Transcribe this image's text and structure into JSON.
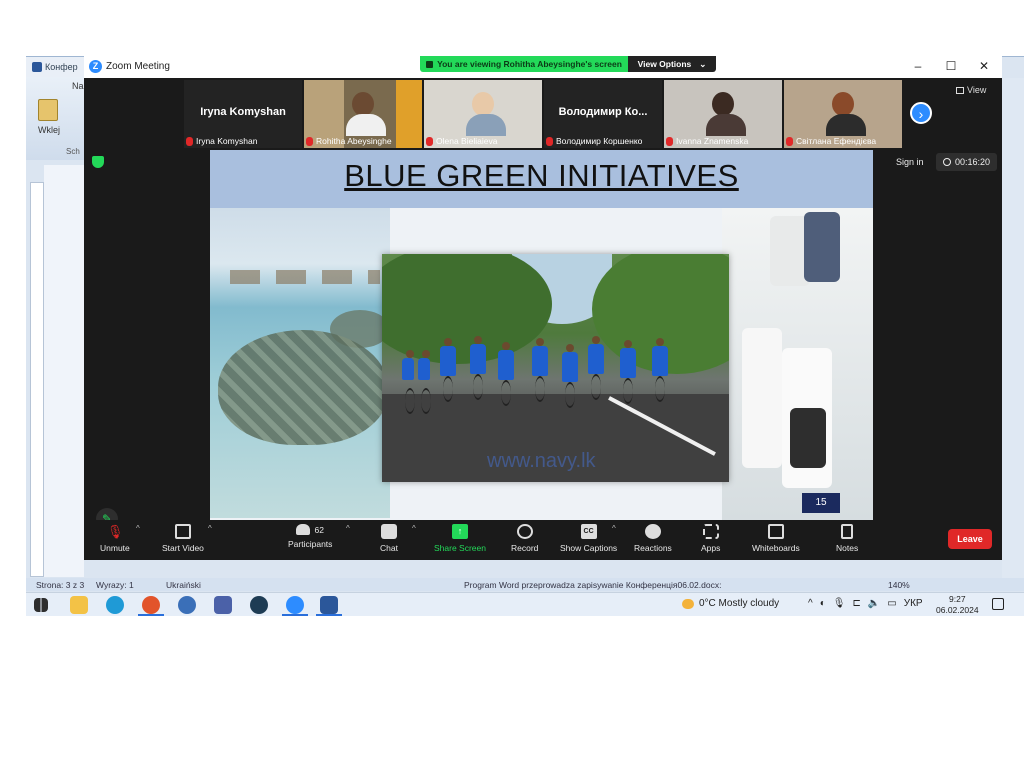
{
  "word": {
    "tab_label": "Конфер",
    "ribbon_na": "Na",
    "paste_label": "Wklej",
    "clipboard_label": "Sch",
    "status_page": "Strona: 3 z 3",
    "status_words": "Wyrazy: 1",
    "status_lang": "Ukraiński",
    "status_saving": "Program Word przeprowadza zapisywanie Конференція06.02.docx:",
    "status_zoom": "140%"
  },
  "zoom": {
    "title": "Zoom Meeting",
    "share_banner": "You are viewing Rohitha Abeysinghe's screen",
    "view_options": "View Options",
    "view_label": "View",
    "sign_in": "Sign in",
    "timer": "00:16:20",
    "participants": [
      {
        "display": "Iryna Komyshan",
        "caption": "Iryna Komyshan",
        "video": false
      },
      {
        "display": "",
        "caption": "Rohitha Abeysinghe",
        "video": true
      },
      {
        "display": "",
        "caption": "Olena Bieliaieva",
        "video": true
      },
      {
        "display": "Володимир Ко...",
        "caption": "Володимир Коршенко",
        "video": false
      },
      {
        "display": "",
        "caption": "Ivanna Znamenska",
        "video": true
      },
      {
        "display": "",
        "caption": "Світлана Ефендієва",
        "video": true
      }
    ],
    "slide": {
      "title": "BLUE GREEN INITIATIVES",
      "watermark": "www.navy.lk",
      "page_number": "15"
    },
    "toolbar": {
      "unmute": "Unmute",
      "start_video": "Start Video",
      "participants": "Participants",
      "participants_count": "62",
      "chat": "Chat",
      "share_screen": "Share Screen",
      "record": "Record",
      "show_captions": "Show Captions",
      "captions_icon": "CC",
      "reactions": "Reactions",
      "apps": "Apps",
      "whiteboards": "Whiteboards",
      "notes": "Notes",
      "leave": "Leave"
    }
  },
  "taskbar": {
    "weather": "0°C  Mostly cloudy",
    "lang": "УКР",
    "time": "9:27",
    "date": "06.02.2024"
  },
  "colors": {
    "zoom_bg": "#1a1a1a",
    "share_green": "#23d959",
    "zoom_blue": "#2d8cff",
    "leave_red": "#e02828",
    "slide_header": "#a9bfde"
  }
}
